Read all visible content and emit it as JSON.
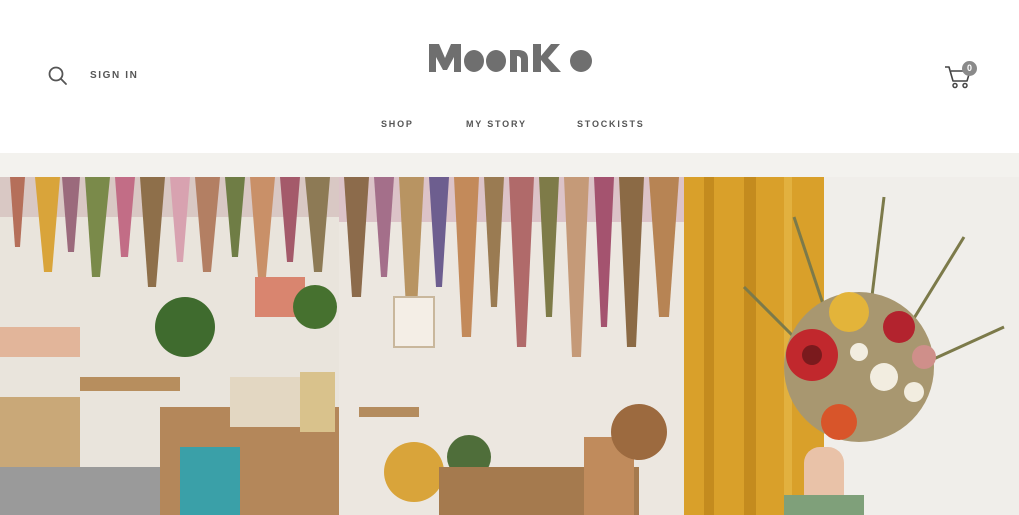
{
  "header": {
    "sign_in_label": "SIGN IN",
    "cart_count": "0",
    "brand_color": "#6f6f6f"
  },
  "nav": {
    "items": [
      {
        "label": "SHOP"
      },
      {
        "label": "MY STORY"
      },
      {
        "label": "STOCKISTS"
      }
    ]
  },
  "colors": {
    "band": "#f3f2ee",
    "curtain": "#d9a02a",
    "text": "#555555"
  },
  "icons": {
    "search": "search-icon",
    "cart": "shopping-cart-icon"
  },
  "hero": {
    "images": [
      {
        "name": "shop-interior-photo"
      },
      {
        "name": "hanging-flowers-wall-photo"
      },
      {
        "name": "dried-bouquet-photo"
      }
    ]
  }
}
